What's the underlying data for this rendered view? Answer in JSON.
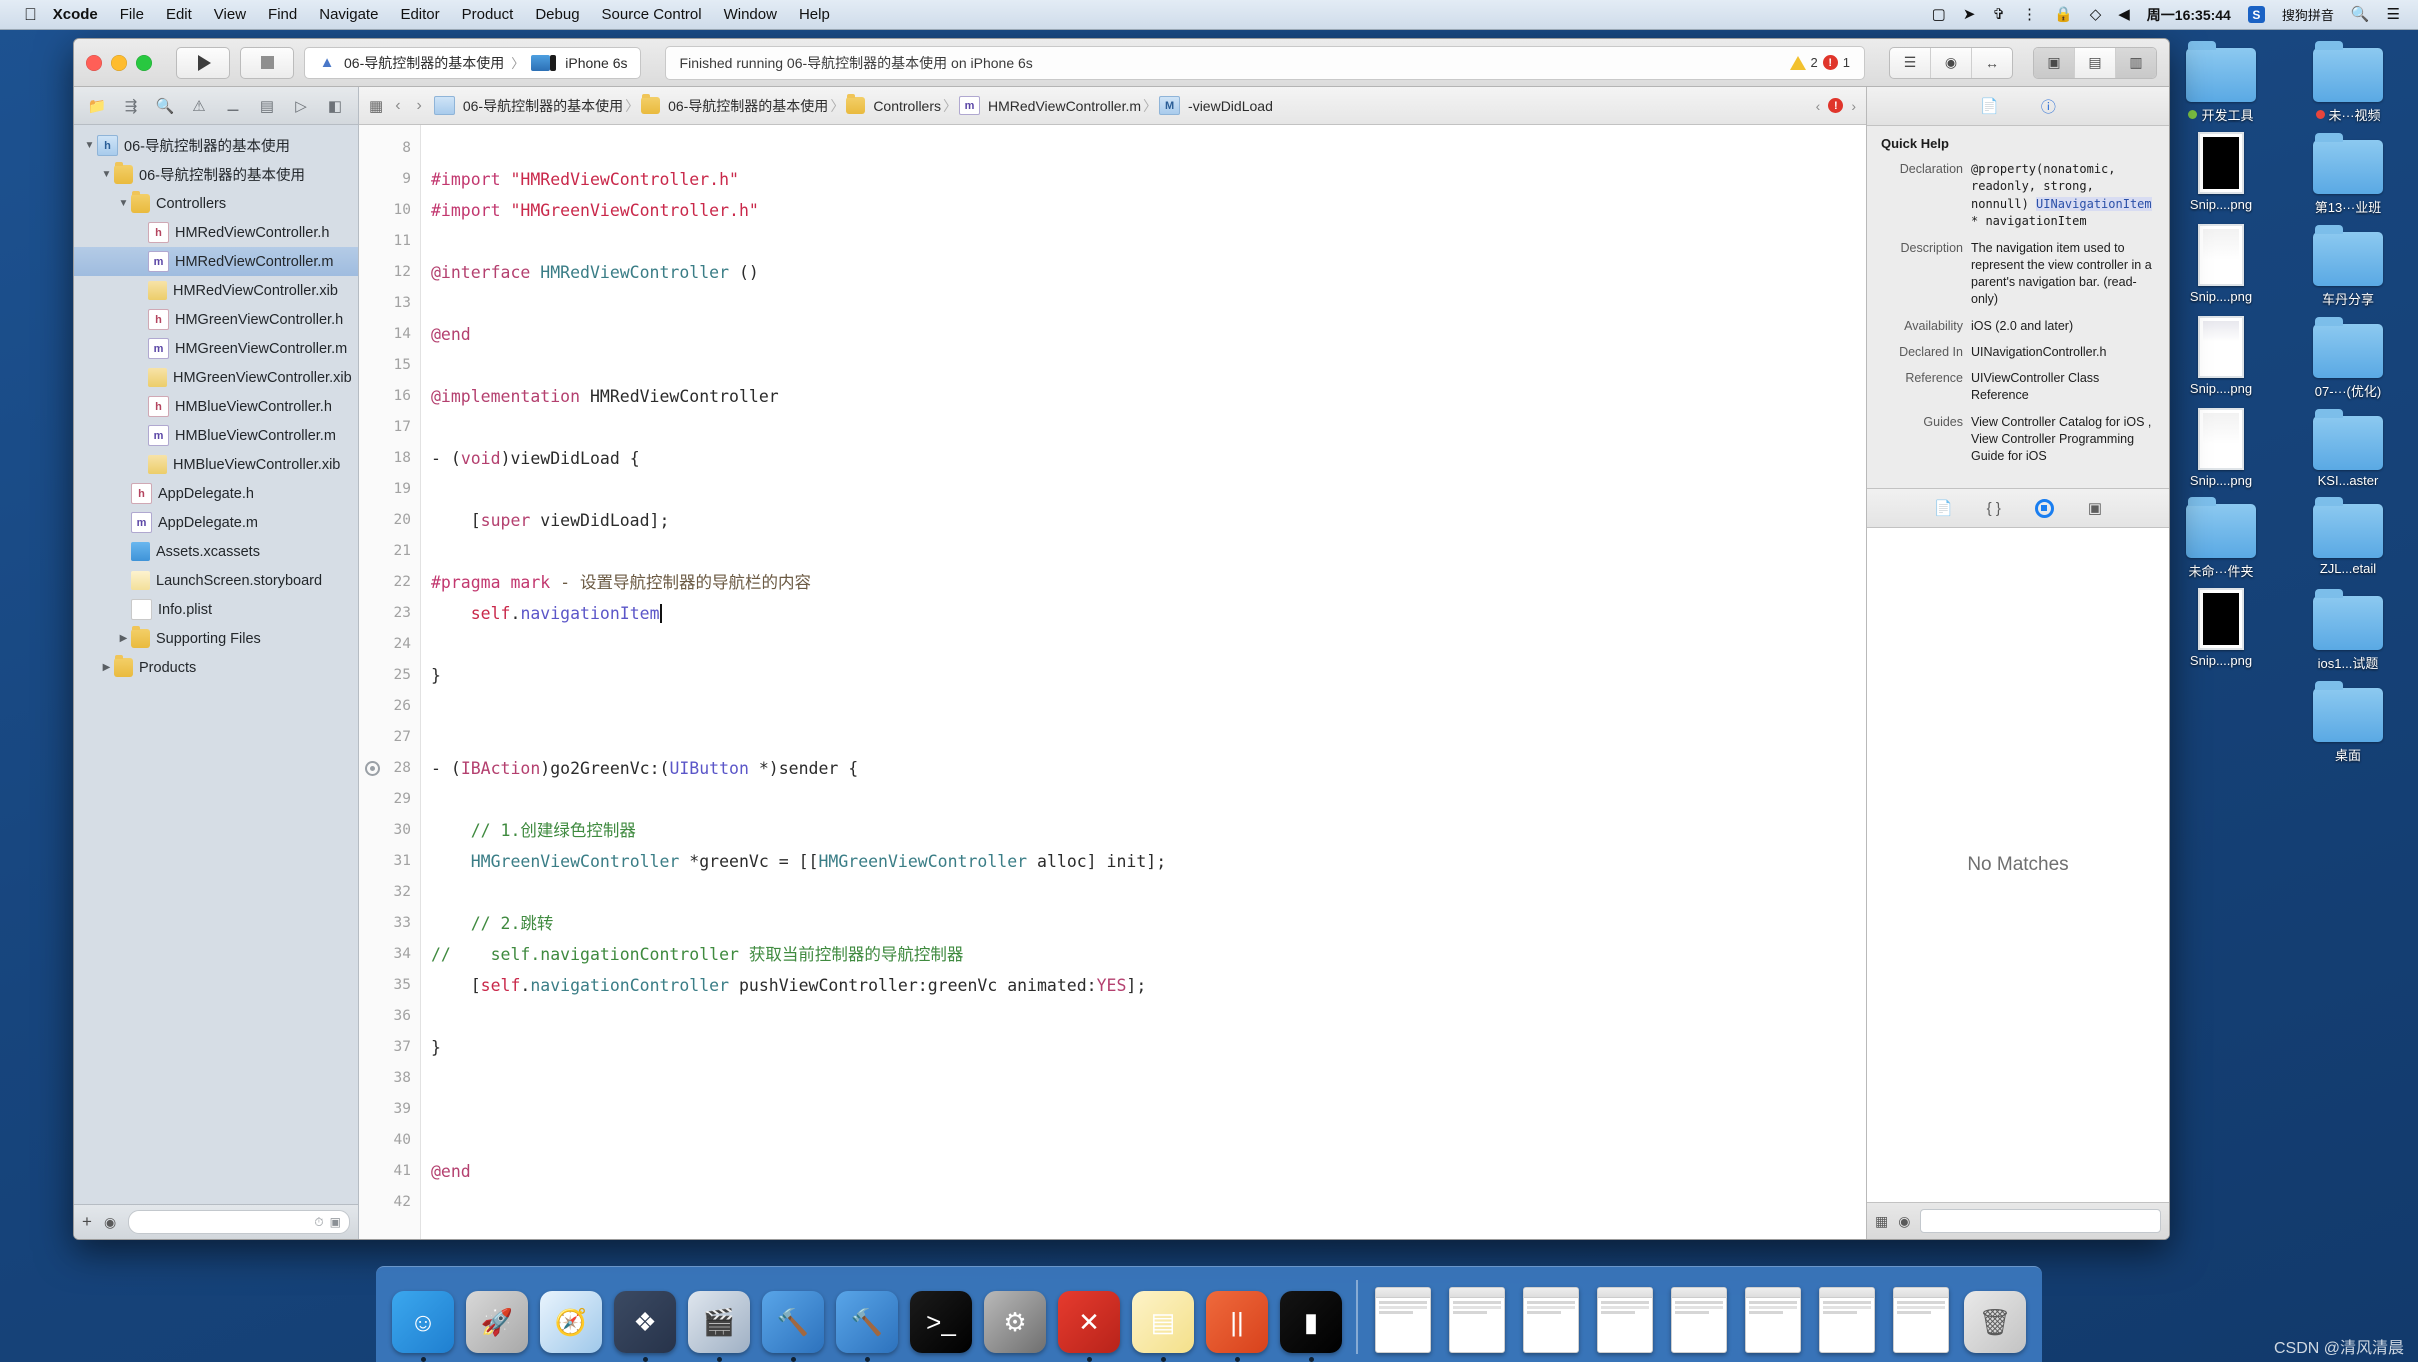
{
  "menubar": {
    "apple": "",
    "items": [
      {
        "label": "Xcode",
        "bold": true
      },
      {
        "label": "File",
        "bold": false
      },
      {
        "label": "Edit",
        "bold": false
      },
      {
        "label": "View",
        "bold": false
      },
      {
        "label": "Find",
        "bold": false
      },
      {
        "label": "Navigate",
        "bold": false
      },
      {
        "label": "Editor",
        "bold": false
      },
      {
        "label": "Product",
        "bold": false
      },
      {
        "label": "Debug",
        "bold": false
      },
      {
        "label": "Source Control",
        "bold": false
      },
      {
        "label": "Window",
        "bold": false
      },
      {
        "label": "Help",
        "bold": false
      }
    ],
    "status_icons": [
      "screen-recording-icon",
      "airplay-icon",
      "bluetooth-icon",
      "vpn-icon",
      "lock-icon",
      "dropbox-icon",
      "volume-icon"
    ],
    "clock": "周一16:35:44",
    "input_method_badge": "S",
    "input_method": "搜狗拼音",
    "search_icon": "search-icon",
    "control_center_icon": "list-icon"
  },
  "desktop": {
    "icons": [
      {
        "label": "开发工具",
        "type": "folder",
        "tag": "#7cc142"
      },
      {
        "label": "未···视频",
        "type": "folder",
        "tag": "#e8453c"
      },
      {
        "label": "Snip....png",
        "type": "png-dark",
        "tag": ""
      },
      {
        "label": "第13···业班",
        "type": "folder",
        "tag": ""
      },
      {
        "label": "Snip....png",
        "type": "png-light",
        "tag": ""
      },
      {
        "label": "车丹分享",
        "type": "folder",
        "tag": ""
      },
      {
        "label": "Snip....png",
        "type": "png-mixed",
        "tag": ""
      },
      {
        "label": "07-···(优化)",
        "type": "folder",
        "tag": ""
      },
      {
        "label": "Snip....png",
        "type": "png-light",
        "tag": ""
      },
      {
        "label": "KSI...aster",
        "type": "folder",
        "tag": ""
      },
      {
        "label": "未命···件夹",
        "type": "folder",
        "tag": ""
      },
      {
        "label": "ZJL...etail",
        "type": "folder",
        "tag": ""
      },
      {
        "label": "Snip....png",
        "type": "png-dark",
        "tag": ""
      },
      {
        "label": "ios1...试题",
        "type": "folder",
        "tag": ""
      },
      {
        "label": "",
        "type": "none",
        "tag": ""
      },
      {
        "label": "桌面",
        "type": "folder",
        "tag": ""
      }
    ]
  },
  "toolbar": {
    "run_button": "run-button",
    "stop_button": "stop-button",
    "scheme_name": "06-导航控制器的基本使用",
    "scheme_separator": "〉",
    "destination": "iPhone 6s",
    "status_text": "Finished running 06-导航控制器的基本使用 on iPhone 6s",
    "warning_count": "2",
    "error_count": "1",
    "editor_segments": [
      "standard-editor-icon",
      "assistant-editor-icon",
      "version-editor-icon"
    ],
    "view_segments": [
      "hide-navigator-icon",
      "hide-debug-icon",
      "hide-utilities-icon"
    ]
  },
  "navigator": {
    "tabs": [
      "folder-icon",
      "source-control-icon",
      "search-icon",
      "issue-icon",
      "test-icon",
      "debug-icon",
      "breakpoint-icon",
      "report-icon"
    ],
    "active_tab_index": 0,
    "tree": [
      {
        "label": "06-导航控制器的基本使用",
        "indent": 0,
        "twisty": "▼",
        "icon": "proj",
        "selected": false
      },
      {
        "label": "06-导航控制器的基本使用",
        "indent": 1,
        "twisty": "▼",
        "icon": "folder",
        "selected": false
      },
      {
        "label": "Controllers",
        "indent": 2,
        "twisty": "▼",
        "icon": "folder",
        "selected": false
      },
      {
        "label": "HMRedViewController.h",
        "indent": 3,
        "twisty": "",
        "icon": "h",
        "selected": false
      },
      {
        "label": "HMRedViewController.m",
        "indent": 3,
        "twisty": "",
        "icon": "m",
        "selected": true
      },
      {
        "label": "HMRedViewController.xib",
        "indent": 3,
        "twisty": "",
        "icon": "xib",
        "selected": false
      },
      {
        "label": "HMGreenViewController.h",
        "indent": 3,
        "twisty": "",
        "icon": "h",
        "selected": false
      },
      {
        "label": "HMGreenViewController.m",
        "indent": 3,
        "twisty": "",
        "icon": "m",
        "selected": false
      },
      {
        "label": "HMGreenViewController.xib",
        "indent": 3,
        "twisty": "",
        "icon": "xib",
        "selected": false
      },
      {
        "label": "HMBlueViewController.h",
        "indent": 3,
        "twisty": "",
        "icon": "h",
        "selected": false
      },
      {
        "label": "HMBlueViewController.m",
        "indent": 3,
        "twisty": "",
        "icon": "m",
        "selected": false
      },
      {
        "label": "HMBlueViewController.xib",
        "indent": 3,
        "twisty": "",
        "icon": "xib",
        "selected": false
      },
      {
        "label": "AppDelegate.h",
        "indent": 2,
        "twisty": "",
        "icon": "h",
        "selected": false
      },
      {
        "label": "AppDelegate.m",
        "indent": 2,
        "twisty": "",
        "icon": "m",
        "selected": false
      },
      {
        "label": "Assets.xcassets",
        "indent": 2,
        "twisty": "",
        "icon": "xcassets",
        "selected": false
      },
      {
        "label": "LaunchScreen.storyboard",
        "indent": 2,
        "twisty": "",
        "icon": "sb",
        "selected": false
      },
      {
        "label": "Info.plist",
        "indent": 2,
        "twisty": "",
        "icon": "plist",
        "selected": false
      },
      {
        "label": "Supporting Files",
        "indent": 2,
        "twisty": "▶",
        "icon": "folder",
        "selected": false
      },
      {
        "label": "Products",
        "indent": 1,
        "twisty": "▶",
        "icon": "folder",
        "selected": false
      }
    ],
    "footer": {
      "add_button": "+",
      "filter_placeholder": "",
      "recent_icon": "clock-icon",
      "source_icon": "modified-icon"
    }
  },
  "jumpbar": {
    "related_icon": "related-items-icon",
    "back": "‹",
    "forward": "›",
    "crumbs": [
      {
        "label": "06-导航控制器的基本使用",
        "icon": "project-icon"
      },
      {
        "label": "06-导航控制器的基本使用",
        "icon": "folder-icon"
      },
      {
        "label": "Controllers",
        "icon": "folder-icon"
      },
      {
        "label": "HMRedViewController.m",
        "icon": "m-file-icon"
      },
      {
        "label": "-viewDidLoad",
        "icon": "method-icon"
      }
    ],
    "prev_issue": "‹",
    "issue_badge": "error-icon",
    "next_issue": "›"
  },
  "editor": {
    "first_line": 8,
    "breakpoint_line": 28,
    "lines": [
      {
        "n": 8,
        "tokens": []
      },
      {
        "n": 9,
        "tokens": [
          {
            "t": "#import ",
            "c": "pp"
          },
          {
            "t": "\"HMRedViewController.h\"",
            "c": "str"
          }
        ]
      },
      {
        "n": 10,
        "tokens": [
          {
            "t": "#import ",
            "c": "pp"
          },
          {
            "t": "\"HMGreenViewController.h\"",
            "c": "str"
          }
        ]
      },
      {
        "n": 11,
        "tokens": []
      },
      {
        "n": 12,
        "tokens": [
          {
            "t": "@interface ",
            "c": "k"
          },
          {
            "t": "HMRedViewController",
            "c": "typ"
          },
          {
            "t": " ()",
            "c": "mth"
          }
        ]
      },
      {
        "n": 13,
        "tokens": []
      },
      {
        "n": 14,
        "tokens": [
          {
            "t": "@end",
            "c": "k"
          }
        ]
      },
      {
        "n": 15,
        "tokens": []
      },
      {
        "n": 16,
        "tokens": [
          {
            "t": "@implementation ",
            "c": "k"
          },
          {
            "t": "HMRedViewController",
            "c": "mth"
          }
        ]
      },
      {
        "n": 17,
        "tokens": []
      },
      {
        "n": 18,
        "tokens": [
          {
            "t": "- (",
            "c": "mth"
          },
          {
            "t": "void",
            "c": "k"
          },
          {
            "t": ")viewDidLoad {",
            "c": "mth"
          }
        ]
      },
      {
        "n": 19,
        "tokens": []
      },
      {
        "n": 20,
        "tokens": [
          {
            "t": "    [",
            "c": "mth"
          },
          {
            "t": "super",
            "c": "k"
          },
          {
            "t": " viewDidLoad];",
            "c": "mth"
          }
        ]
      },
      {
        "n": 21,
        "tokens": []
      },
      {
        "n": 22,
        "tokens": [
          {
            "t": "#pragma mark ",
            "c": "pp"
          },
          {
            "t": "- 设置导航控制器的导航栏的内容",
            "c": "cmt2"
          }
        ]
      },
      {
        "n": 23,
        "tokens": [
          {
            "t": "    ",
            "c": "mth"
          },
          {
            "t": "self",
            "c": "str"
          },
          {
            "t": ".",
            "c": "mth"
          },
          {
            "t": "navigationItem",
            "c": "prop"
          },
          {
            "t": "|CURSOR|",
            "c": "cur"
          }
        ]
      },
      {
        "n": 24,
        "tokens": []
      },
      {
        "n": 25,
        "tokens": [
          {
            "t": "}",
            "c": "mth"
          }
        ]
      },
      {
        "n": 26,
        "tokens": []
      },
      {
        "n": 27,
        "tokens": []
      },
      {
        "n": 28,
        "tokens": [
          {
            "t": "- (",
            "c": "mth"
          },
          {
            "t": "IBAction",
            "c": "k"
          },
          {
            "t": ")go2GreenVc:(",
            "c": "mth"
          },
          {
            "t": "UIButton",
            "c": "prop"
          },
          {
            "t": " *)sender {",
            "c": "mth"
          }
        ]
      },
      {
        "n": 29,
        "tokens": []
      },
      {
        "n": 30,
        "tokens": [
          {
            "t": "    // 1.创建绿色控制器",
            "c": "cmt"
          }
        ]
      },
      {
        "n": 31,
        "tokens": [
          {
            "t": "    ",
            "c": "mth"
          },
          {
            "t": "HMGreenViewController",
            "c": "typ"
          },
          {
            "t": " *greenVc = [[",
            "c": "mth"
          },
          {
            "t": "HMGreenViewController",
            "c": "typ"
          },
          {
            "t": " alloc] init];",
            "c": "mth"
          }
        ]
      },
      {
        "n": 32,
        "tokens": []
      },
      {
        "n": 33,
        "tokens": [
          {
            "t": "    // 2.跳转",
            "c": "cmt"
          }
        ]
      },
      {
        "n": 34,
        "tokens": [
          {
            "t": "//    self.navigationController 获取当前控制器的导航控制器",
            "c": "cmt"
          }
        ]
      },
      {
        "n": 35,
        "tokens": [
          {
            "t": "    [",
            "c": "mth"
          },
          {
            "t": "self",
            "c": "str"
          },
          {
            "t": ".",
            "c": "mth"
          },
          {
            "t": "navigationController",
            "c": "typ"
          },
          {
            "t": " pushViewController:greenVc animated:",
            "c": "mth"
          },
          {
            "t": "YES",
            "c": "k"
          },
          {
            "t": "];",
            "c": "mth"
          }
        ]
      },
      {
        "n": 36,
        "tokens": []
      },
      {
        "n": 37,
        "tokens": [
          {
            "t": "}",
            "c": "mth"
          }
        ]
      },
      {
        "n": 38,
        "tokens": []
      },
      {
        "n": 39,
        "tokens": []
      },
      {
        "n": 40,
        "tokens": []
      },
      {
        "n": 41,
        "tokens": [
          {
            "t": "@end",
            "c": "k"
          }
        ]
      },
      {
        "n": 42,
        "tokens": []
      }
    ]
  },
  "inspector": {
    "tabs": [
      "file-inspector-icon",
      "quick-help-icon"
    ],
    "active_tab_index": 1,
    "quick_help": {
      "title": "Quick Help",
      "rows": [
        {
          "label": "Declaration",
          "value": "@property(nonatomic, readonly, strong, nonnull) UINavigationItem * navigationItem",
          "mono": true,
          "highlight": "UINavigationItem"
        },
        {
          "label": "Description",
          "value": "The navigation item used to represent the view controller in a parent's navigation bar. (read-only)",
          "mono": false,
          "highlight": ""
        },
        {
          "label": "Availability",
          "value": "iOS (2.0 and later)",
          "mono": false,
          "highlight": ""
        },
        {
          "label": "Declared In",
          "value": "UINavigationController.h",
          "mono": false,
          "highlight": "link"
        },
        {
          "label": "Reference",
          "value": "UIViewController Class Reference",
          "mono": false,
          "highlight": "link"
        },
        {
          "label": "Guides",
          "value": "View Controller Catalog for iOS , View Controller Programming Guide for iOS",
          "mono": false,
          "highlight": "link"
        }
      ]
    },
    "library_tabs": [
      "file-template-library-icon",
      "code-snippet-library-icon",
      "object-library-icon",
      "media-library-icon"
    ],
    "library_active_index": 2,
    "library_empty_text": "No Matches",
    "footer_filter_placeholder": ""
  },
  "dock": {
    "apps": [
      {
        "name": "Finder",
        "icon": "finder-icon",
        "running": true
      },
      {
        "name": "Launchpad",
        "icon": "launchpad-icon",
        "running": false
      },
      {
        "name": "Safari",
        "icon": "safari-icon",
        "running": false
      },
      {
        "name": "Sketch",
        "icon": "sketch-icon",
        "running": true
      },
      {
        "name": "QuickTime Player",
        "icon": "quicktime-icon",
        "running": true
      },
      {
        "name": "Xcode Beta",
        "icon": "xcode-beta-icon",
        "running": true
      },
      {
        "name": "Xcode",
        "icon": "xcode-icon",
        "running": true
      },
      {
        "name": "Terminal",
        "icon": "terminal-icon",
        "running": false
      },
      {
        "name": "System Preferences",
        "icon": "system-preferences-icon",
        "running": false
      },
      {
        "name": "XMind",
        "icon": "xmind-icon",
        "running": true
      },
      {
        "name": "Notes",
        "icon": "notes-icon",
        "running": true
      },
      {
        "name": "Parallels",
        "icon": "parallels-icon",
        "running": true
      },
      {
        "name": "iTerm",
        "icon": "iterm-icon",
        "running": true
      }
    ],
    "minimized": [
      {
        "name": "window-thumb-1",
        "icon": "minimized-window-icon"
      },
      {
        "name": "window-thumb-2",
        "icon": "minimized-window-icon"
      },
      {
        "name": "window-thumb-3",
        "icon": "minimized-window-icon"
      },
      {
        "name": "window-thumb-4",
        "icon": "minimized-window-icon"
      },
      {
        "name": "window-thumb-5",
        "icon": "minimized-window-icon"
      },
      {
        "name": "window-thumb-6",
        "icon": "minimized-window-icon"
      },
      {
        "name": "window-thumb-7",
        "icon": "minimized-window-icon"
      },
      {
        "name": "window-thumb-8",
        "icon": "minimized-window-icon"
      }
    ],
    "trash": {
      "name": "Trash",
      "icon": "trash-icon"
    }
  },
  "watermark": "CSDN @清风清晨"
}
